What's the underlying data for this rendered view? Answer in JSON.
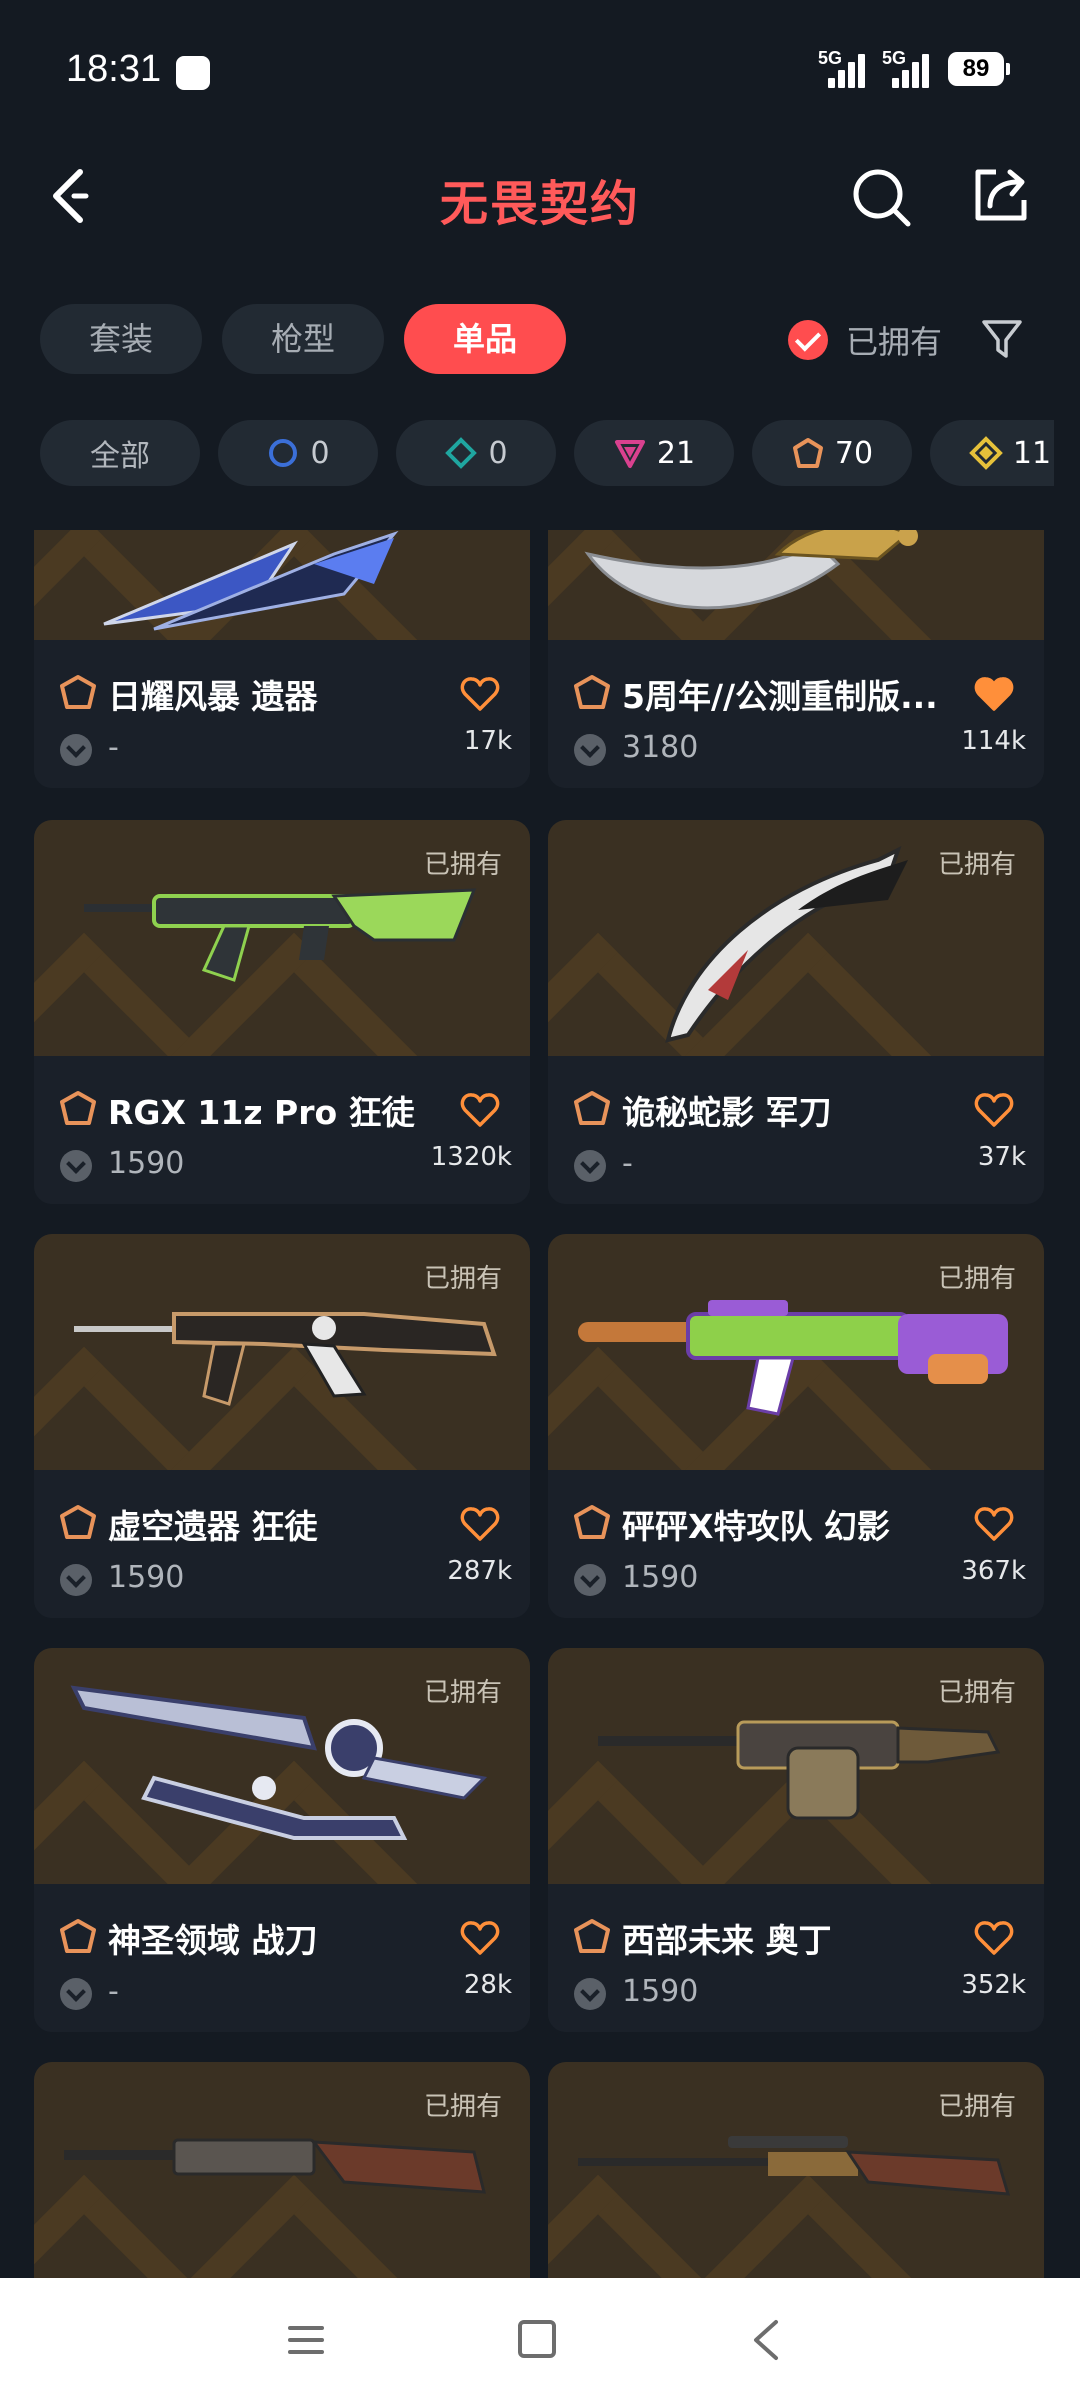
{
  "status_bar": {
    "time": "18:31",
    "net1": "5G",
    "net2": "5G",
    "battery": "89"
  },
  "header": {
    "title": "无畏契约"
  },
  "tabs": [
    {
      "label": "套装",
      "active": false
    },
    {
      "label": "枪型",
      "active": false
    },
    {
      "label": "单品",
      "active": true
    }
  ],
  "owned_filter": {
    "label": "已拥有",
    "checked": true
  },
  "rarity_chips": [
    {
      "label": "全部"
    },
    {
      "icon": "select-tier-icon",
      "count": "0"
    },
    {
      "icon": "deluxe-tier-icon",
      "count": "0"
    },
    {
      "icon": "premium-tier-icon",
      "count": "21"
    },
    {
      "icon": "exclusive-tier-icon",
      "count": "70"
    },
    {
      "icon": "ultra-tier-icon",
      "count": "11"
    }
  ],
  "items": [
    {
      "name": "日耀风暴 遗器",
      "price": "-",
      "likes": "17k",
      "favorited": false,
      "owned_tag": ""
    },
    {
      "name": "5周年//公测重制版...",
      "price": "3180",
      "likes": "114k",
      "favorited": true,
      "owned_tag": ""
    },
    {
      "name": "RGX 11z Pro 狂徒",
      "price": "1590",
      "likes": "1320k",
      "favorited": false,
      "owned_tag": "已拥有"
    },
    {
      "name": "诡秘蛇影 军刀",
      "price": "-",
      "likes": "37k",
      "favorited": false,
      "owned_tag": "已拥有"
    },
    {
      "name": "虚空遗器 狂徒",
      "price": "1590",
      "likes": "287k",
      "favorited": false,
      "owned_tag": "已拥有"
    },
    {
      "name": "砰砰X特攻队 幻影",
      "price": "1590",
      "likes": "367k",
      "favorited": false,
      "owned_tag": "已拥有"
    },
    {
      "name": "神圣领域 战刀",
      "price": "-",
      "likes": "28k",
      "favorited": false,
      "owned_tag": "已拥有"
    },
    {
      "name": "西部未来 奥丁",
      "price": "1590",
      "likes": "352k",
      "favorited": false,
      "owned_tag": "已拥有"
    },
    {
      "name": "",
      "price": "",
      "likes": "",
      "favorited": false,
      "owned_tag": "已拥有"
    },
    {
      "name": "",
      "price": "",
      "likes": "",
      "favorited": false,
      "owned_tag": "已拥有"
    }
  ],
  "colors": {
    "accent": "#ff4d4f",
    "rarity": "#e8935a",
    "favorite": "#ff8f3a",
    "background": "#141a22"
  }
}
